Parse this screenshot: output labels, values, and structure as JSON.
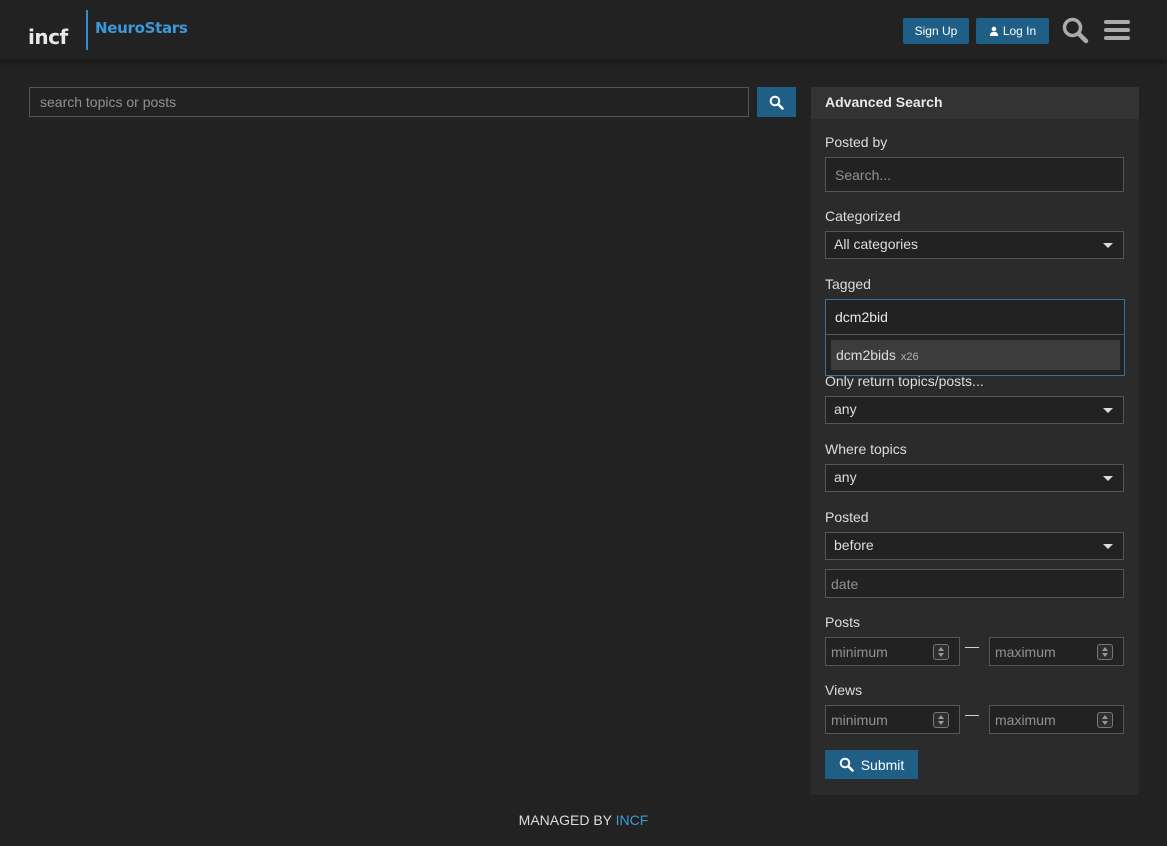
{
  "header": {
    "logo_left": "incf",
    "logo_right": "NeuroStars",
    "signup_label": "Sign Up",
    "login_label": "Log In",
    "search_icon": "search-icon",
    "menu_icon": "hamburger-menu-icon"
  },
  "search": {
    "placeholder": "search topics or posts"
  },
  "advanced": {
    "title": "Advanced Search",
    "posted_by_label": "Posted by",
    "posted_by_placeholder": "Search...",
    "categorized_label": "Categorized",
    "categorized_value": "All categories",
    "tagged_label": "Tagged",
    "tagged_value": "dcm2bid",
    "tag_suggestion_name": "dcm2bids",
    "tag_suggestion_count": "x26",
    "only_return_label": "Only return topics/posts...",
    "only_return_value": "any",
    "where_topics_label": "Where topics",
    "where_topics_value": "any",
    "posted_label": "Posted",
    "posted_value": "before",
    "date_placeholder": "date",
    "posts_label": "Posts",
    "posts_min_placeholder": "minimum",
    "posts_max_placeholder": "maximum",
    "views_label": "Views",
    "views_min_placeholder": "minimum",
    "views_max_placeholder": "maximum",
    "range_dash": "—",
    "submit_label": "Submit"
  },
  "footer": {
    "managed_by": "MANAGED BY",
    "link_text": "INCF"
  },
  "colors": {
    "background": "#222222",
    "accent": "#1f5f86",
    "link": "#3a9ad9"
  }
}
